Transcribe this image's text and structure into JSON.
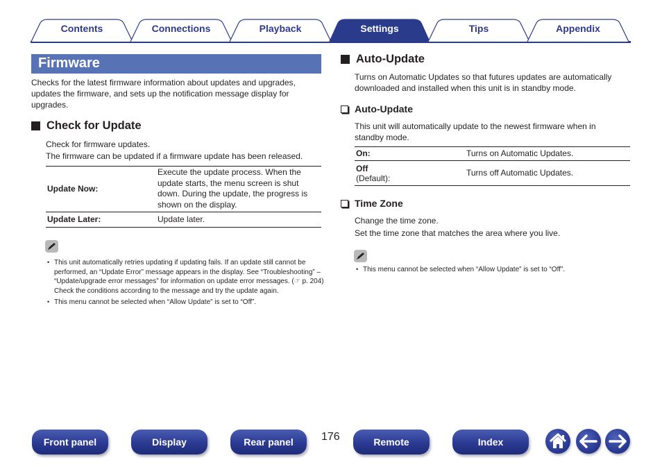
{
  "tabs": [
    {
      "label": "Contents",
      "active": false
    },
    {
      "label": "Connections",
      "active": false
    },
    {
      "label": "Playback",
      "active": false
    },
    {
      "label": "Settings",
      "active": true
    },
    {
      "label": "Tips",
      "active": false
    },
    {
      "label": "Appendix",
      "active": false
    }
  ],
  "colors": {
    "brand": "#2b3b8c",
    "title_bar": "#5872b6",
    "text": "#231f20"
  },
  "left": {
    "title": "Firmware",
    "intro": "Checks for the latest firmware information about updates and upgrades, updates the firmware, and sets up the notification message display for upgrades.",
    "check_for_update": {
      "heading": "Check for Update",
      "line1": "Check for firmware updates.",
      "line2": "The firmware can be updated if a firmware update has been released.",
      "options": [
        {
          "key": "Update Now:",
          "desc": "Execute the update process. When the update starts, the menu screen is shut down. During the update, the progress is shown on the display."
        },
        {
          "key": "Update Later:",
          "desc": "Update later."
        }
      ],
      "note_icon": "pencil-icon",
      "notes": [
        "This unit automatically retries updating if updating fails. If an update still cannot be performed, an “Update Error” message appears in the display. See “Troubleshooting” – “Update/upgrade error messages” for information on update error messages. (☞ p. 204)",
        "Check the conditions according to the message and try the update again.",
        "This menu cannot be selected when “Allow Update” is set to “Off”."
      ]
    }
  },
  "right": {
    "auto_update": {
      "heading": "Auto-Update",
      "desc": "Turns on Automatic Updates so that futures updates are automatically downloaded and installed when this unit is in standby mode.",
      "sub": {
        "heading": "Auto-Update",
        "desc": "This unit will automatically update to the newest firmware when in standby mode.",
        "options": [
          {
            "key": "On:",
            "sub": "",
            "desc": "Turns on Automatic Updates."
          },
          {
            "key": "Off",
            "sub": "(Default):",
            "desc": "Turns off Automatic Updates."
          }
        ]
      }
    },
    "time_zone": {
      "heading": "Time Zone",
      "line1": "Change the time zone.",
      "line2": "Set the time zone that matches the area where you live.",
      "note_icon": "pencil-icon",
      "notes": [
        "This menu cannot be selected when “Allow Update” is set to “Off”."
      ]
    }
  },
  "footer": {
    "buttons": [
      "Front panel",
      "Display",
      "Rear panel",
      "Remote",
      "Index"
    ],
    "page_number": "176",
    "icons": [
      "home-icon",
      "back-arrow-icon",
      "forward-arrow-icon"
    ]
  }
}
